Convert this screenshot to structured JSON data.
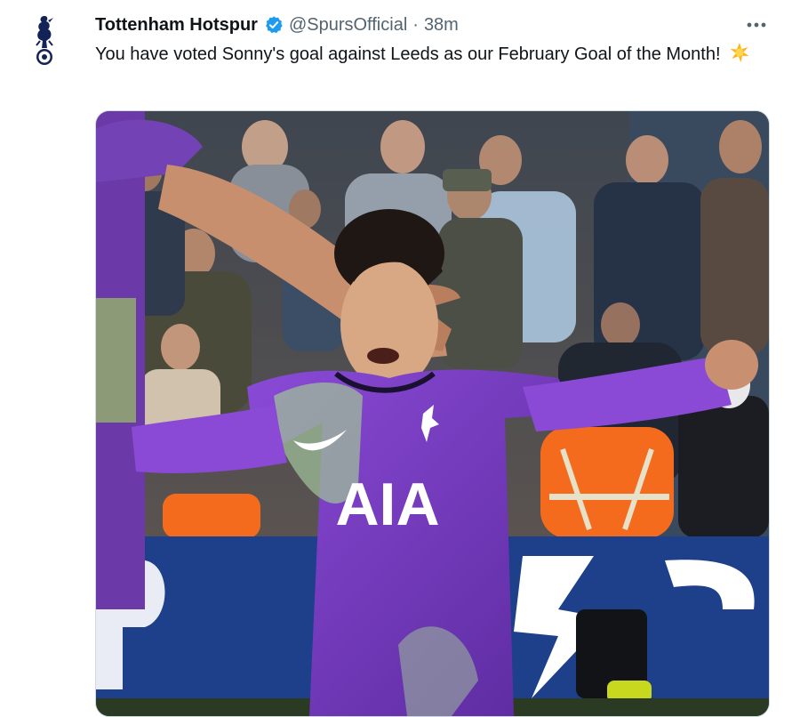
{
  "tweet": {
    "author_name": "Tottenham Hotspur",
    "handle": "@SpursOfficial",
    "separator": "·",
    "time": "38m",
    "text": "You have voted Sonny's goal against Leeds as our February Goal of the Month!",
    "emoji": "🌟",
    "icons": {
      "avatar": "spurs-cockerel-logo",
      "verified": "verified-badge-icon",
      "more": "more-options-icon"
    },
    "colors": {
      "verified": "#1d9bf0",
      "kit_purple": "#7b3fc4",
      "pitch_board": "#1e3f8a"
    }
  },
  "media": {
    "shirt_sponsor": "AIA"
  }
}
